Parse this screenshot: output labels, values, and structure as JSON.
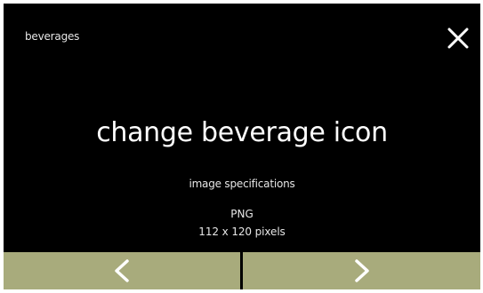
{
  "header": {
    "breadcrumb": "beverages",
    "close_icon": "close-icon"
  },
  "main": {
    "title": "change beverage icon",
    "spec_label": "image specifications",
    "spec_format": "PNG",
    "spec_size": "112 x 120 pixels"
  },
  "footer": {
    "prev_icon": "chevron-left-icon",
    "next_icon": "chevron-right-icon"
  },
  "colors": {
    "background": "#000000",
    "text": "#ffffff",
    "nav_button": "#a8ab7c"
  }
}
